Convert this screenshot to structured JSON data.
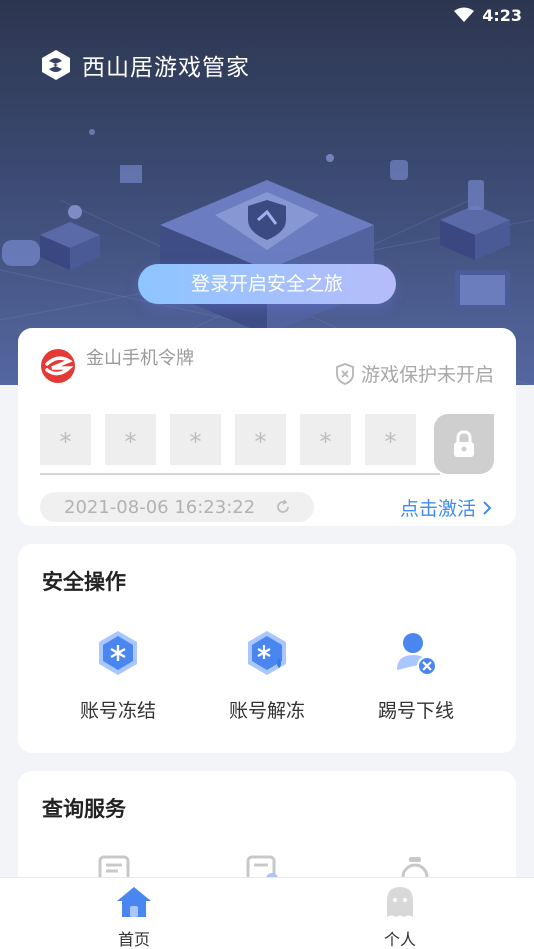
{
  "status": {
    "time": "4:23"
  },
  "app": {
    "title": "西山居游戏管家"
  },
  "hero": {
    "login_button": "登录开启安全之旅"
  },
  "token": {
    "title": "金山手机令牌",
    "protection_status": "游戏保护未开启",
    "code_digits": [
      "*",
      "*",
      "*",
      "*",
      "*",
      "*"
    ],
    "timestamp": "2021-08-06 16:23:22",
    "activate_label": "点击激活"
  },
  "security": {
    "title": "安全操作",
    "items": [
      {
        "label": "账号冻结",
        "icon": "freeze-icon"
      },
      {
        "label": "账号解冻",
        "icon": "unfreeze-icon"
      },
      {
        "label": "踢号下线",
        "icon": "kick-offline-icon"
      }
    ]
  },
  "query": {
    "title": "查询服务"
  },
  "tabbar": {
    "items": [
      {
        "label": "首页",
        "icon": "home-icon",
        "active": true
      },
      {
        "label": "个人",
        "icon": "profile-icon",
        "active": false
      }
    ]
  },
  "colors": {
    "accent": "#3d8cf5",
    "hero_dark": "#2d3650",
    "hero_light": "#5567a0"
  }
}
